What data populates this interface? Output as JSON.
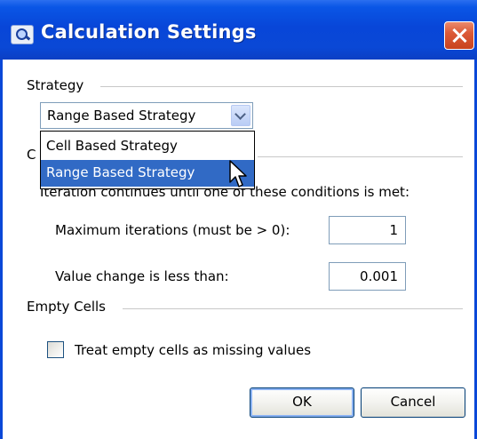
{
  "window": {
    "title": "Calculation Settings"
  },
  "strategy": {
    "group_label": "Strategy",
    "selected": "Range Based Strategy",
    "options": [
      "Cell Based Strategy",
      "Range Based Strategy"
    ],
    "highlighted_option": "Range Based Strategy"
  },
  "convergence": {
    "group_label_visible": "C",
    "description": "Iteration continues until one of these conditions is met:",
    "max_iterations_label": "Maximum iterations (must be > 0):",
    "max_iterations_value": "1",
    "value_change_label": "Value change is less than:",
    "value_change_value": "0.001"
  },
  "empty_cells": {
    "group_label": "Empty Cells",
    "checkbox_label": "Treat empty cells as missing values",
    "checked": false
  },
  "buttons": {
    "ok": "OK",
    "cancel": "Cancel"
  },
  "colors": {
    "titlebar": "#0846d8",
    "selection": "#316ac5",
    "close": "#dc5a38"
  }
}
